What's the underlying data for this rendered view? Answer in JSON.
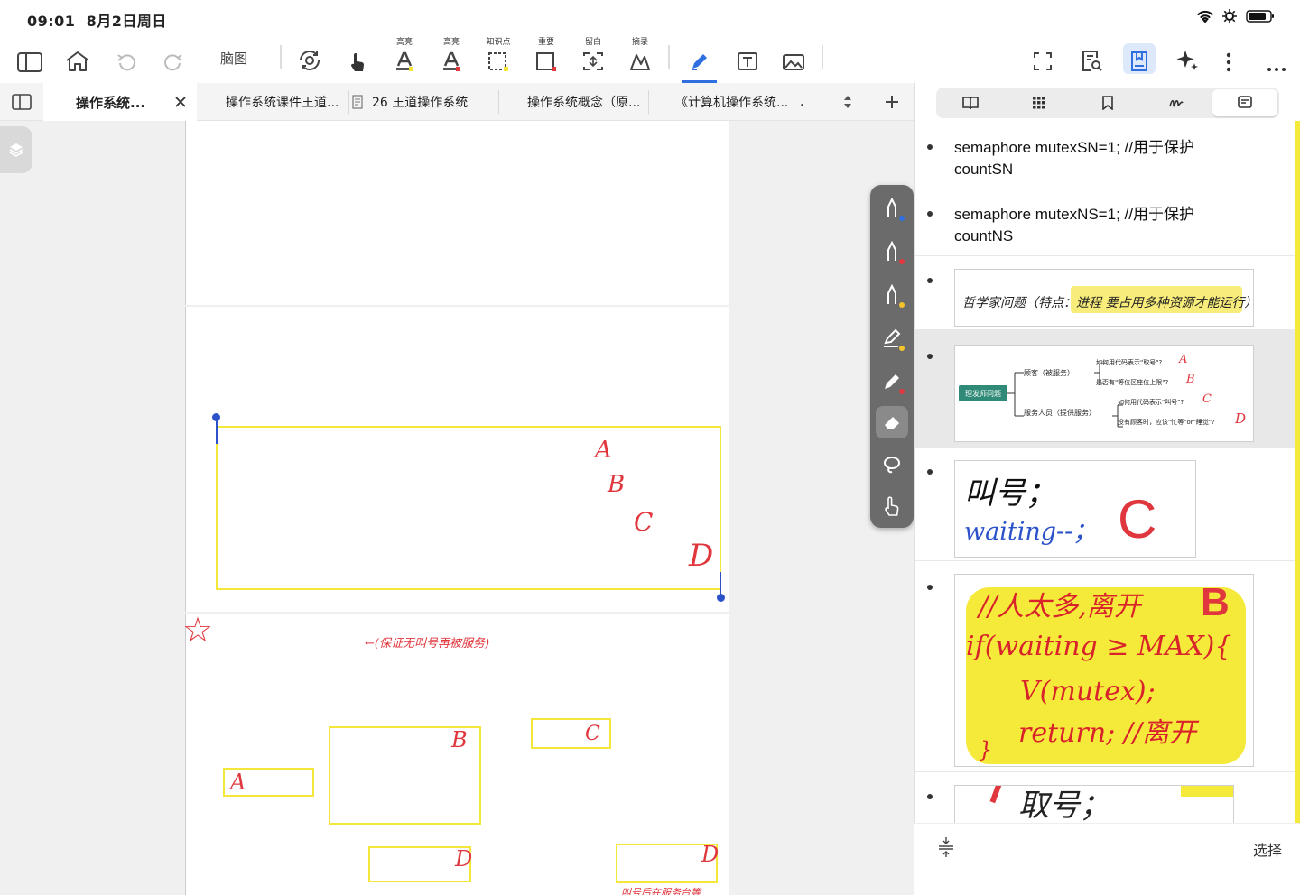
{
  "status": {
    "time": "09:01",
    "date": "8月2日周日"
  },
  "toolbar": {
    "mindmap_label": "脑图",
    "captions": {
      "highlight1": "高亮",
      "highlight2": "高亮",
      "knowledge": "知识点",
      "important": "重要",
      "blank": "留白",
      "excerpt": "摘录"
    }
  },
  "tabs": [
    {
      "label": "操作系统..."
    },
    {
      "label": "操作系统课件王道..."
    },
    {
      "label": "26 王道操作系统"
    },
    {
      "label": "操作系统概念（原..."
    },
    {
      "label": "《计算机操作系统..."
    }
  ],
  "tab_more": ".",
  "canvas": {
    "handwriting": {
      "a": "A",
      "b": "B",
      "c": "C",
      "d": "D",
      "star": "☆",
      "note": "←(保证无叫号再被服务)",
      "bottom_note": "叫号后在服务台等"
    },
    "box_labels": {
      "a": "A",
      "b": "B",
      "c": "C",
      "d1": "D",
      "d2": "D"
    }
  },
  "notes": [
    {
      "text": "semaphore mutexSN=1; //用于保护\ncountSN"
    },
    {
      "text": "semaphore mutexNS=1; //用于保护\ncountNS"
    }
  ],
  "thumbs": {
    "philosopher": {
      "text": "哲学家问题（特点：进程 要占用多种资源才能运行）"
    },
    "mindmap": {
      "root": "理发师问题",
      "branch1": "顾客（被服务）",
      "branch2": "服务人员（提供服务）",
      "leaf1": "如何用代码表示\"取号\"?",
      "leaf2": "是否有\"等位区座位上限\"?",
      "leaf3": "如何用代码表示\"叫号\"?",
      "leaf4": "没有顾客时，应该\"忙等\"or\"睡觉\"?",
      "m1": "A",
      "m2": "B",
      "m3": "C",
      "m4": "D"
    },
    "callnum": {
      "line1": "叫号；",
      "line2": "waiting--；",
      "mark": "C"
    },
    "code": {
      "line1": "//人太多,离开",
      "line2": "if(waiting ≥ MAX){",
      "line3": "V(mutex);",
      "line4": "return; //离开",
      "line5": "}",
      "mark": "B"
    },
    "partial": {
      "text": "取号；"
    }
  },
  "footer": {
    "select_label": "选择"
  },
  "colors": {
    "accent": "#2f6fe0",
    "highlight": "#f5ea3a",
    "ink_red": "#e0363d",
    "ink_blue": "#2c52c9"
  }
}
